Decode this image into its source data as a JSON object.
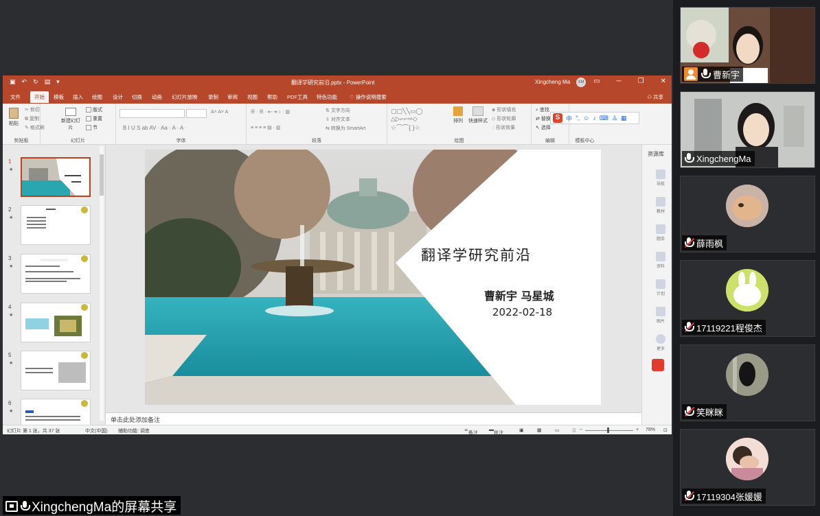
{
  "powerpoint": {
    "window_title": "翻译学研究前沿.pptx - PowerPoint",
    "user_name": "Xingcheng Ma",
    "user_initials": "XM",
    "tabs": [
      "文件",
      "开始",
      "模板",
      "插入",
      "绘图",
      "设计",
      "切换",
      "动画",
      "幻灯片放映",
      "录制",
      "审阅",
      "视图",
      "帮助",
      "PDF工具",
      "特色功能"
    ],
    "active_tab": "开始",
    "tell_me": "操作说明搜索",
    "share_label": "共享",
    "ribbon": {
      "clipboard": {
        "paste": "粘贴",
        "cut": "剪切",
        "copy": "复制",
        "format_painter": "格式刷",
        "group": "剪贴板"
      },
      "slides": {
        "new_slide": "新建幻灯片",
        "layout": "版式",
        "reset": "重置",
        "section": "节",
        "group": "幻灯片"
      },
      "font": {
        "group": "字体"
      },
      "paragraph": {
        "text_direction": "文字方向",
        "align_text": "对齐文本",
        "smartart": "转换为 SmartArt",
        "group": "段落"
      },
      "drawing": {
        "arrange": "排列",
        "quick_styles": "快速样式",
        "shape_fill": "形状填充",
        "shape_outline": "形状轮廓",
        "shape_effects": "形状效果",
        "group": "绘图"
      },
      "editing": {
        "find": "查找",
        "replace": "替换",
        "select": "选择",
        "group": "编辑"
      },
      "template_center": {
        "group": "模板中心"
      }
    },
    "slides": [
      {
        "number": "1",
        "star": "★"
      },
      {
        "number": "2",
        "star": "★"
      },
      {
        "number": "3",
        "star": "★"
      },
      {
        "number": "4",
        "star": "★"
      },
      {
        "number": "5",
        "star": "★"
      },
      {
        "number": "6",
        "star": "★"
      }
    ],
    "current_slide": {
      "title": "翻译学研究前沿",
      "authors": "曹新宇  马星城",
      "date": "2022-02-18"
    },
    "notes_placeholder": "单击此处添加备注",
    "right_pane": {
      "title": "资源库",
      "items": [
        "导航",
        "教材",
        "题库",
        "资料",
        "计划",
        "图片",
        "更多"
      ]
    },
    "status": {
      "slide_info": "幻灯片 第 1 张，共 37 张",
      "language": "中文(中国)",
      "accessibility": "辅助功能: 调查",
      "notes": "备注",
      "comments": "批注",
      "zoom": "78%"
    }
  },
  "screen_share_label": "XingchengMa的屏幕共享",
  "participants": [
    {
      "name": "曹新宇",
      "muted": false,
      "host": true
    },
    {
      "name": "XingchengMa",
      "muted": false,
      "host": false
    },
    {
      "name": "薛雨枫",
      "muted": true,
      "host": false
    },
    {
      "name": "17119221程俊杰",
      "muted": true,
      "host": false
    },
    {
      "name": "笑眯眯",
      "muted": true,
      "host": false
    },
    {
      "name": "17119304张媛媛",
      "muted": true,
      "host": false
    }
  ],
  "colors": {
    "ppt_accent": "#b7472a",
    "muted_mic": "#e13b3b",
    "host_badge": "#f08a2e"
  }
}
